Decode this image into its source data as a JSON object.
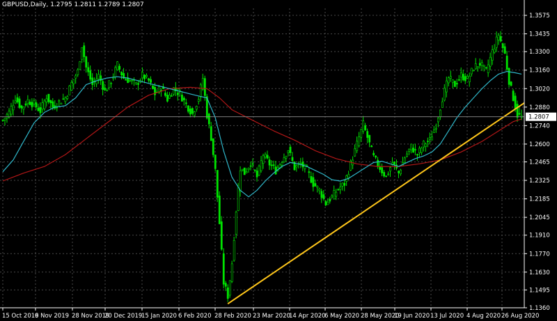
{
  "header": {
    "symbol": "GBPUSD",
    "timeframe": "Daily",
    "ohlc": "1.2795 1.2811 1.2789 1.2807"
  },
  "colors": {
    "background": "#000000",
    "grid": "#4a4a4a",
    "axis_text": "#ffffff",
    "candle": "#00e600",
    "ma_fast": "#2fb7c9",
    "ma_slow": "#b31717",
    "trendline": "#ffc61a",
    "price_line": "#7f7f7f",
    "price_tag_bg": "#ffffff"
  },
  "chart_data": {
    "type": "line",
    "title": "GBPUSD,Daily",
    "xlabel": "",
    "ylabel": "",
    "ylim": [
      1.136,
      1.3628
    ],
    "grid": true,
    "y_ticks": [
      "1.3575",
      "1.3435",
      "1.3300",
      "1.3160",
      "1.3020",
      "1.2880",
      "1.2740",
      "1.2600",
      "1.2465",
      "1.2325",
      "1.2185",
      "1.2045",
      "1.1910",
      "1.1770",
      "1.1630",
      "1.1495",
      "1.1360"
    ],
    "x_ticks": [
      "15 Oct 2019",
      "6 Nov 2019",
      "28 Nov 2019",
      "20 Dec 2019",
      "15 Jan 2020",
      "6 Feb 2020",
      "28 Feb 2020",
      "23 Mar 2020",
      "14 Apr 2020",
      "6 May 2020",
      "28 May 2020",
      "19 Jun 2020",
      "13 Jul 2020",
      "4 Aug 2020",
      "26 Aug 2020"
    ],
    "current_price": "1.2807",
    "series": [
      {
        "kind": "close",
        "values": [
          [
            0,
            1.278
          ],
          [
            3,
            1.284
          ],
          [
            6,
            1.295
          ],
          [
            9,
            1.287
          ],
          [
            12,
            1.293
          ],
          [
            15,
            1.29
          ],
          [
            18,
            1.285
          ],
          [
            21,
            1.296
          ],
          [
            24,
            1.288
          ],
          [
            27,
            1.292
          ],
          [
            30,
            1.295
          ],
          [
            33,
            1.306
          ],
          [
            36,
            1.315
          ],
          [
            38,
            1.335
          ],
          [
            40,
            1.318
          ],
          [
            43,
            1.305
          ],
          [
            46,
            1.312
          ],
          [
            49,
            1.3
          ],
          [
            52,
            1.308
          ],
          [
            55,
            1.32
          ],
          [
            58,
            1.31
          ],
          [
            61,
            1.308
          ],
          [
            64,
            1.305
          ],
          [
            67,
            1.312
          ],
          [
            70,
            1.308
          ],
          [
            73,
            1.298
          ],
          [
            76,
            1.303
          ],
          [
            79,
            1.294
          ],
          [
            82,
            1.302
          ],
          [
            85,
            1.298
          ],
          [
            88,
            1.29
          ],
          [
            91,
            1.283
          ],
          [
            94,
            1.295
          ],
          [
            96,
            1.31
          ],
          [
            98,
            1.282
          ],
          [
            100,
            1.265
          ],
          [
            102,
            1.24
          ],
          [
            104,
            1.2
          ],
          [
            106,
            1.155
          ],
          [
            108,
            1.145
          ],
          [
            110,
            1.17
          ],
          [
            112,
            1.21
          ],
          [
            114,
            1.242
          ],
          [
            116,
            1.238
          ],
          [
            119,
            1.246
          ],
          [
            122,
            1.235
          ],
          [
            125,
            1.252
          ],
          [
            128,
            1.245
          ],
          [
            131,
            1.24
          ],
          [
            134,
            1.248
          ],
          [
            137,
            1.256
          ],
          [
            140,
            1.242
          ],
          [
            143,
            1.245
          ],
          [
            146,
            1.24
          ],
          [
            149,
            1.23
          ],
          [
            152,
            1.225
          ],
          [
            155,
            1.215
          ],
          [
            158,
            1.22
          ],
          [
            161,
            1.226
          ],
          [
            164,
            1.23
          ],
          [
            167,
            1.245
          ],
          [
            170,
            1.26
          ],
          [
            173,
            1.275
          ],
          [
            175,
            1.265
          ],
          [
            178,
            1.25
          ],
          [
            181,
            1.242
          ],
          [
            184,
            1.235
          ],
          [
            187,
            1.246
          ],
          [
            190,
            1.238
          ],
          [
            193,
            1.25
          ],
          [
            196,
            1.258
          ],
          [
            199,
            1.252
          ],
          [
            202,
            1.26
          ],
          [
            205,
            1.263
          ],
          [
            208,
            1.275
          ],
          [
            211,
            1.295
          ],
          [
            214,
            1.31
          ],
          [
            217,
            1.305
          ],
          [
            220,
            1.312
          ],
          [
            223,
            1.309
          ],
          [
            226,
            1.318
          ],
          [
            229,
            1.321
          ],
          [
            232,
            1.315
          ],
          [
            235,
            1.33
          ],
          [
            238,
            1.343
          ],
          [
            241,
            1.328
          ],
          [
            243,
            1.308
          ],
          [
            245,
            1.295
          ],
          [
            247,
            1.282
          ],
          [
            249,
            1.2807
          ]
        ]
      },
      {
        "kind": "ma_fast",
        "values": [
          [
            0,
            1.239
          ],
          [
            5,
            1.248
          ],
          [
            10,
            1.262
          ],
          [
            15,
            1.276
          ],
          [
            20,
            1.284
          ],
          [
            25,
            1.288
          ],
          [
            30,
            1.289
          ],
          [
            35,
            1.295
          ],
          [
            40,
            1.305
          ],
          [
            45,
            1.308
          ],
          [
            50,
            1.31
          ],
          [
            55,
            1.311
          ],
          [
            60,
            1.31
          ],
          [
            65,
            1.308
          ],
          [
            70,
            1.306
          ],
          [
            75,
            1.304
          ],
          [
            80,
            1.302
          ],
          [
            85,
            1.3
          ],
          [
            90,
            1.298
          ],
          [
            95,
            1.296
          ],
          [
            98,
            1.295
          ],
          [
            102,
            1.28
          ],
          [
            106,
            1.255
          ],
          [
            110,
            1.235
          ],
          [
            114,
            1.225
          ],
          [
            118,
            1.22
          ],
          [
            122,
            1.225
          ],
          [
            126,
            1.232
          ],
          [
            130,
            1.238
          ],
          [
            134,
            1.243
          ],
          [
            138,
            1.246
          ],
          [
            142,
            1.245
          ],
          [
            146,
            1.243
          ],
          [
            150,
            1.24
          ],
          [
            154,
            1.237
          ],
          [
            158,
            1.233
          ],
          [
            162,
            1.232
          ],
          [
            166,
            1.234
          ],
          [
            170,
            1.238
          ],
          [
            174,
            1.242
          ],
          [
            178,
            1.246
          ],
          [
            182,
            1.247
          ],
          [
            186,
            1.245
          ],
          [
            190,
            1.243
          ],
          [
            194,
            1.246
          ],
          [
            198,
            1.249
          ],
          [
            202,
            1.251
          ],
          [
            206,
            1.254
          ],
          [
            210,
            1.26
          ],
          [
            214,
            1.27
          ],
          [
            218,
            1.28
          ],
          [
            222,
            1.288
          ],
          [
            226,
            1.295
          ],
          [
            230,
            1.302
          ],
          [
            234,
            1.308
          ],
          [
            238,
            1.313
          ],
          [
            242,
            1.315
          ],
          [
            246,
            1.314
          ],
          [
            249,
            1.313
          ]
        ]
      },
      {
        "kind": "ma_slow",
        "values": [
          [
            0,
            1.232
          ],
          [
            10,
            1.238
          ],
          [
            20,
            1.243
          ],
          [
            30,
            1.252
          ],
          [
            40,
            1.264
          ],
          [
            50,
            1.276
          ],
          [
            60,
            1.288
          ],
          [
            70,
            1.297
          ],
          [
            80,
            1.302
          ],
          [
            90,
            1.303
          ],
          [
            98,
            1.302
          ],
          [
            104,
            1.295
          ],
          [
            110,
            1.286
          ],
          [
            120,
            1.278
          ],
          [
            130,
            1.27
          ],
          [
            140,
            1.263
          ],
          [
            150,
            1.255
          ],
          [
            160,
            1.249
          ],
          [
            170,
            1.245
          ],
          [
            180,
            1.243
          ],
          [
            190,
            1.243
          ],
          [
            200,
            1.245
          ],
          [
            210,
            1.248
          ],
          [
            220,
            1.254
          ],
          [
            230,
            1.262
          ],
          [
            240,
            1.272
          ],
          [
            245,
            1.277
          ],
          [
            249,
            1.279
          ]
        ]
      },
      {
        "kind": "trendline",
        "values": [
          [
            108,
            1.139
          ],
          [
            249,
            1.288
          ]
        ]
      }
    ]
  }
}
